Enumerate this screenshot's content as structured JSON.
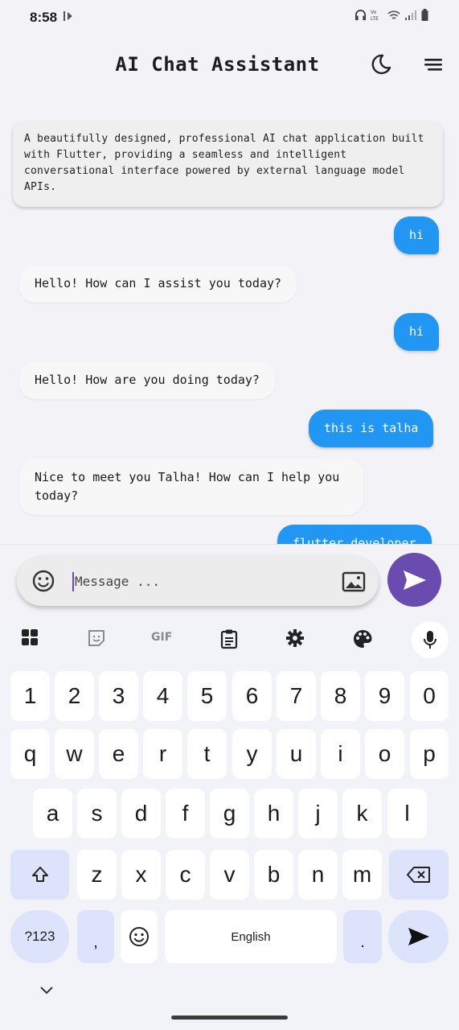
{
  "status": {
    "time": "8:58",
    "net_label": "Vo)\nLTE"
  },
  "app": {
    "title": "AI Chat Assistant"
  },
  "chat": {
    "intro": "A beautifully designed, professional AI chat application built with Flutter, providing a seamless and intelligent conversational interface powered by external language model APIs.",
    "messages": [
      {
        "role": "user",
        "text": "hi"
      },
      {
        "role": "ai",
        "text": "Hello! How can I assist you today?"
      },
      {
        "role": "user",
        "text": "hi"
      },
      {
        "role": "ai",
        "text": "Hello! How are you doing today?"
      },
      {
        "role": "user",
        "text": "this is talha"
      },
      {
        "role": "ai",
        "text": "Nice to meet you Talha! How can I help you today?"
      },
      {
        "role": "user",
        "text": "flutter developer"
      }
    ]
  },
  "input": {
    "placeholder": "Message ..."
  },
  "keyboard_toolbar": {
    "gif_label": "GIF"
  },
  "keyboard": {
    "row_numbers": [
      "1",
      "2",
      "3",
      "4",
      "5",
      "6",
      "7",
      "8",
      "9",
      "0"
    ],
    "row1": [
      "q",
      "w",
      "e",
      "r",
      "t",
      "y",
      "u",
      "i",
      "o",
      "p"
    ],
    "row2": [
      "a",
      "s",
      "d",
      "f",
      "g",
      "h",
      "j",
      "k",
      "l"
    ],
    "row3": [
      "z",
      "x",
      "c",
      "v",
      "b",
      "n",
      "m"
    ],
    "symbols_label": "?123",
    "comma": ",",
    "space_label": "English",
    "period": "."
  },
  "colors": {
    "user_bubble": "#2196f3",
    "send_button": "#6a4bb0",
    "accent_key": "#dde3fa"
  }
}
